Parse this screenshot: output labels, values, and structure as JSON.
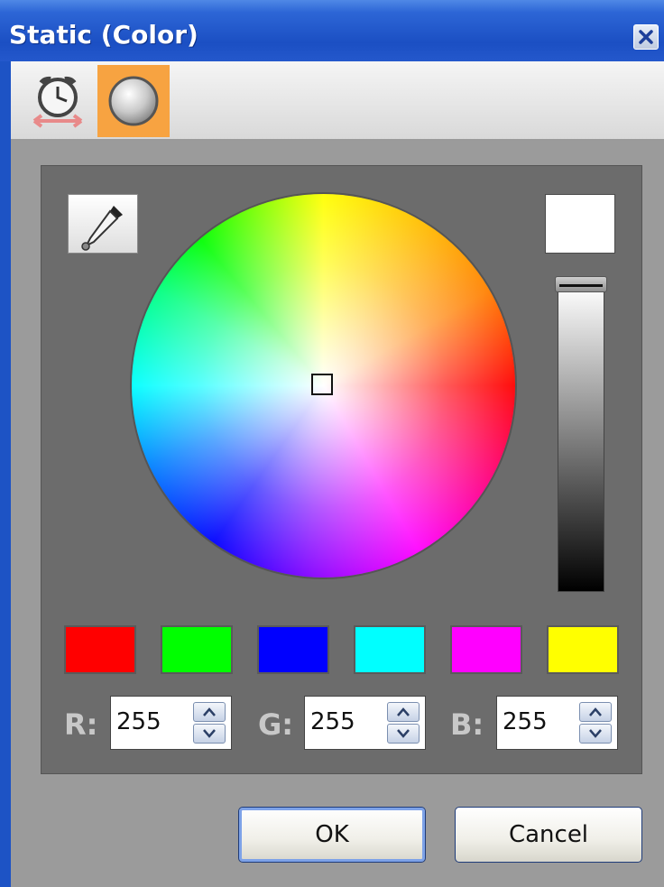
{
  "window": {
    "title": "Static (Color)",
    "close_icon": "close-icon"
  },
  "toolbar": {
    "tools": [
      {
        "name": "alarm-clock-tool",
        "icon": "alarm-clock-resize-icon",
        "active": false
      },
      {
        "name": "color-tool",
        "icon": "gray-sphere-icon",
        "active": true
      }
    ],
    "active_color": "#f7a341"
  },
  "picker": {
    "eyedropper_icon": "eyedropper-icon",
    "preview_color": "#ffffff",
    "lightness_level": 1.0,
    "wheel_cursor": "center"
  },
  "swatches": [
    {
      "name": "red",
      "color": "#ff0000"
    },
    {
      "name": "green",
      "color": "#00ff00"
    },
    {
      "name": "blue",
      "color": "#0000ff"
    },
    {
      "name": "cyan",
      "color": "#00ffff"
    },
    {
      "name": "magenta",
      "color": "#ff00ff"
    },
    {
      "name": "yellow",
      "color": "#ffff00"
    }
  ],
  "rgb": {
    "r_label": "R:",
    "r_value": "255",
    "g_label": "G:",
    "g_value": "255",
    "b_label": "B:",
    "b_value": "255"
  },
  "buttons": {
    "ok_label": "OK",
    "cancel_label": "Cancel"
  }
}
